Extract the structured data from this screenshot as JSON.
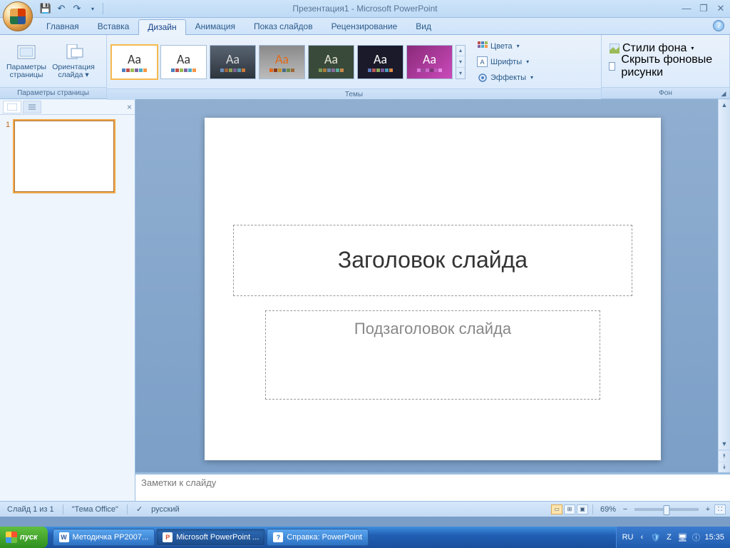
{
  "title": "Презентация1 - Microsoft PowerPoint",
  "tabs": [
    "Главная",
    "Вставка",
    "Дизайн",
    "Анимация",
    "Показ слайдов",
    "Рецензирование",
    "Вид"
  ],
  "active_tab": 2,
  "ribbon": {
    "page_setup": {
      "page_params": "Параметры страницы",
      "orientation": "Ориентация слайда",
      "group": "Параметры страницы"
    },
    "themes": {
      "group": "Темы",
      "colors": "Цвета",
      "fonts": "Шрифты",
      "effects": "Эффекты",
      "items": [
        "Aa",
        "Aa",
        "Aa",
        "Aa",
        "Aa",
        "Aa",
        "Aa"
      ]
    },
    "background": {
      "group": "Фон",
      "styles": "Стили фона",
      "hide": "Скрыть фоновые рисунки"
    }
  },
  "slide": {
    "title_ph": "Заголовок слайда",
    "subtitle_ph": "Подзаголовок слайда"
  },
  "notes": "Заметки к слайду",
  "status": {
    "slide": "Слайд 1 из 1",
    "theme": "\"Тема Office\"",
    "lang": "русский",
    "zoom": "69%"
  },
  "thumb": {
    "num": "1"
  },
  "taskbar": {
    "start": "пуск",
    "items": [
      {
        "label": "Методичка PP2007...",
        "ico": "W",
        "color": "#2b579a"
      },
      {
        "label": "Microsoft PowerPoint ...",
        "ico": "P",
        "color": "#d24726",
        "active": true
      },
      {
        "label": "Справка: PowerPoint",
        "ico": "?",
        "color": "#5aa5ef"
      }
    ],
    "tray": {
      "lang": "RU",
      "time": "15:35"
    }
  }
}
